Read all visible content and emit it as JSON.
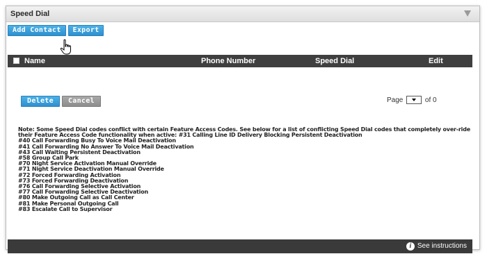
{
  "panel": {
    "title": "Speed Dial",
    "collapse_icon": "chevron-down-icon"
  },
  "toolbar": {
    "add_contact_label": "Add Contact",
    "export_label": "Export"
  },
  "table": {
    "columns": [
      "Name",
      "Phone Number",
      "Speed Dial",
      "Edit"
    ],
    "rows": []
  },
  "actions": {
    "delete_label": "Delete",
    "cancel_label": "Cancel"
  },
  "pagination": {
    "page_label": "Page",
    "of_label": "of 0"
  },
  "notes": {
    "intro_line1": "Note: Some Speed Dial codes conflict with certain Feature Access Codes. See below for a list of conflicting Speed Dial codes that completely over-ride",
    "intro_line2": "their Feature Access Code functionality when active: #31 Calling Line ID Delivery Blocking Persistent Deactivation",
    "codes": [
      "#40 Call Forwarding Busy To Voice Mail Deactivation",
      "#41 Call Forwarding No Answer To Voice Mail Deactivation",
      "#43 Call Waiting Persistent Deactivation",
      "#58 Group Call Park",
      "#70 Night Service Activation Manual Override",
      "#71 Night Service Deactivation Manual Override",
      "#72 Forced Forwarding Activation",
      "#73 Forced Forwarding Deactivation",
      "#76 Call Forwarding Selective Activation",
      "#77 Call Forwarding Selective Deactivation",
      "#80 Make Outgoing Call as Call Center",
      "#81 Make Personal Outgoing Call",
      "#83 Escalate Call to Supervisor"
    ]
  },
  "footer": {
    "instructions_label": "See instructions",
    "info_icon": "info-icon"
  },
  "colors": {
    "primary_button": "#2f8fcf",
    "secondary_button": "#8c8c8c",
    "table_header": "#3f3f3f",
    "footer": "#3a3a3a"
  }
}
